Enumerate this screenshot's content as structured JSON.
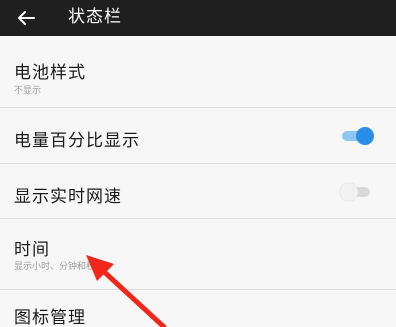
{
  "app_bar": {
    "back_icon": "arrow-left-icon",
    "title": "状态栏"
  },
  "settings": {
    "battery_style": {
      "title": "电池样式",
      "subtitle": "不显示"
    },
    "battery_percentage": {
      "title": "电量百分比显示",
      "toggle_on": true
    },
    "network_speed": {
      "title": "显示实时网速",
      "toggle_on": false
    },
    "time": {
      "title": "时间",
      "subtitle": "显示小时、分钟和秒"
    },
    "icon_management": {
      "title": "图标管理"
    }
  },
  "colors": {
    "app_bar": "#1f1f1f",
    "toggle_on": "#2a8ee8",
    "annotation_arrow": "#f0271a"
  }
}
